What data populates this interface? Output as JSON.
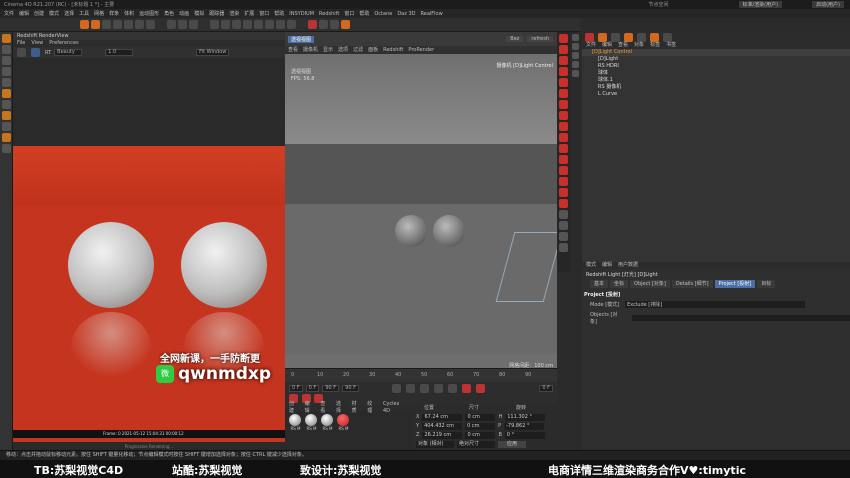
{
  "window": {
    "title": "Cinema 4D R21.207 (RC) - [未标题 1 *] - 主要",
    "top_right_a": "节点空间",
    "top_right_b": "标准/渲染(用户)",
    "top_right_c": "启动(用户)"
  },
  "menu": [
    "文件",
    "编辑",
    "创建",
    "模式",
    "选择",
    "工具",
    "网格",
    "样条",
    "体积",
    "运动图形",
    "角色",
    "动画",
    "模拟",
    "跟踪器",
    "渲染",
    "扩展",
    "窗口",
    "帮助",
    "INSYDIUM",
    "Redshift",
    "窗口",
    "帮助",
    "Octane",
    "Daz 3D",
    "RealFlow"
  ],
  "renderview": {
    "title": "Redshift RenderView",
    "menu": [
      "File",
      "View",
      "Preferences"
    ],
    "mode_label": "RT",
    "mode_value": "Beauty",
    "zoom": "1.0",
    "fit_label": "Fit Window",
    "info_line": "Frame: 0     2021-05-12   15:04:31   00:00:12",
    "progress": "Progressive Rendering..."
  },
  "viewport": {
    "tab": "透视视图",
    "menu": [
      "查看",
      "摄像机",
      "显示",
      "选项",
      "过滤",
      "面板",
      "Redshift",
      "ProRender"
    ],
    "camera_label": "[D]Light Control",
    "camera_prefix": "摄像机",
    "status_title": "透视视图",
    "status_fps": "FPS: 56.8",
    "grid_info": "网格间距：100 cm",
    "buttons": [
      "Bez",
      "refresh"
    ]
  },
  "timeline": {
    "ticks": [
      "0",
      "10",
      "20",
      "30",
      "40",
      "50",
      "60",
      "70",
      "80",
      "90"
    ],
    "frame_end": "0 F",
    "start": "0 F",
    "current": "0 F",
    "end": "90 F",
    "end2": "90 F"
  },
  "materials": {
    "menu": [
      "创建",
      "编辑",
      "查看",
      "选择",
      "材质",
      "纹理",
      "Cycles 4D"
    ],
    "items": [
      "RS M",
      "RS M",
      "RS M",
      "RS M"
    ]
  },
  "coordinates": {
    "headers": [
      "位置",
      "尺寸",
      "旋转"
    ],
    "rows": [
      {
        "axis": "X",
        "pos": "67.24 cm",
        "size": "0 cm",
        "rot_label": "H",
        "rot": "111.302 °"
      },
      {
        "axis": "Y",
        "pos": "404.432 cm",
        "size": "0 cm",
        "rot_label": "P",
        "rot": "-79.862 °"
      },
      {
        "axis": "Z",
        "pos": "26.219 cm",
        "size": "0 cm",
        "rot_label": "B",
        "rot": "0 °"
      }
    ],
    "dropdown1": "对象 (相对)",
    "dropdown2": "绝对尺寸",
    "apply": "应用"
  },
  "objects": {
    "menu": [
      "文件",
      "编辑",
      "查看",
      "对象",
      "标签",
      "书签"
    ],
    "rows": [
      {
        "name": "[D]Light Control",
        "level": 0,
        "selected": true
      },
      {
        "name": "[D]Light",
        "level": 1,
        "selected": false
      },
      {
        "name": "RS HDRI",
        "level": 1,
        "selected": false
      },
      {
        "name": "球体",
        "level": 1,
        "selected": false
      },
      {
        "name": "球体.1",
        "level": 1,
        "selected": false
      },
      {
        "name": "RS 摄像机",
        "level": 1,
        "selected": false
      },
      {
        "name": "L Curve",
        "level": 1,
        "selected": false
      }
    ]
  },
  "attributes": {
    "menu": [
      "模式",
      "编辑",
      "用户数据"
    ],
    "object_line": "Redshift Light [灯光] [D]Light",
    "tabs": [
      "基本",
      "坐标",
      "Object [对象]",
      "Details [细节]",
      "Project [投射]",
      "目标"
    ],
    "active_tab": "Project [投射]",
    "section": "Project [投射]",
    "mode_label": "Mode [模式]",
    "mode_value": "Exclude [排除]",
    "objects_label": "Objects [对象]"
  },
  "status": {
    "text": "移动：点击并拖动鼠标移动元素。按住 SHIFT 键量化移动；节点编辑模式时按住 SHIFT 键增加选择对象；按住 CTRL 键减少选择对象。"
  },
  "watermark": {
    "line1": "全网新课，一手防断更",
    "logo": "微",
    "line2": "qwnmdxp"
  },
  "banner": {
    "a": "TB:苏梨视觉C4D",
    "b": "站酷:苏梨视觉",
    "c": "致设计:苏梨视觉",
    "d": "电商详情三维渲染商务合作V♥:timytic"
  },
  "colors": {
    "accent": "#4c6ea3",
    "render_bg": "#c5341e",
    "redshift_red": "#c9302c"
  }
}
